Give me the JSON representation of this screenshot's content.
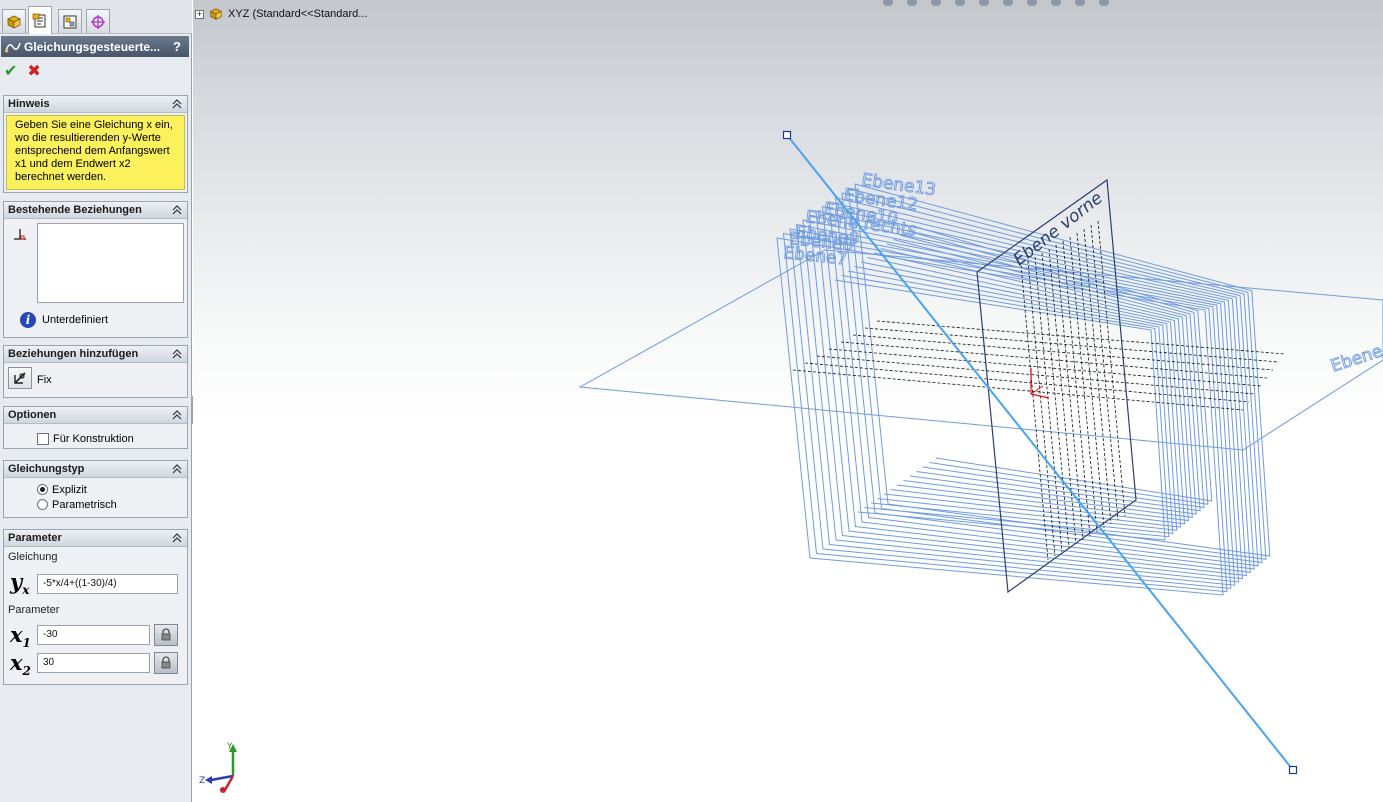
{
  "property_manager": {
    "header_title": "Gleichungsgesteuerte...",
    "help_label": "?",
    "ok_symbol": "✔",
    "cancel_symbol": "✖",
    "hint": {
      "title": "Hinweis",
      "text": "Geben Sie eine Gleichung x ein, wo die resultierenden y-Werte entsprechend dem Anfangswert x1 und dem Endwert x2 berechnet werden."
    },
    "existing_relations": {
      "title": "Bestehende Beziehungen",
      "status": "Unterdefiniert"
    },
    "add_relations": {
      "title": "Beziehungen hinzufügen",
      "fix_label": "Fix"
    },
    "options": {
      "title": "Optionen",
      "construction_label": "Für Konstruktion",
      "construction_checked": false
    },
    "equation_type": {
      "title": "Gleichungstyp",
      "options": [
        "Explizit",
        "Parametrisch"
      ],
      "selected": "Explizit"
    },
    "parameters": {
      "title": "Parameter",
      "equation_label": "Gleichung",
      "yx_symbol": "y",
      "yx_sub": "x",
      "equation_value": "-5*x/4+((1-30)/4)",
      "parameter_label": "Parameter",
      "x1_symbol": "x",
      "x1_sub": "1",
      "x1_value": "-30",
      "x2_symbol": "x",
      "x2_sub": "2",
      "x2_value": "30"
    }
  },
  "viewport": {
    "tree_item": "XYZ  (Standard<<Standard...",
    "plane_labels": [
      "Ebene13",
      "Ebene12",
      "Ebene10",
      "Ebene rechts",
      "Ebene9",
      "Ebene8",
      "Ebene7",
      "Ebene vorne",
      "Ebene"
    ],
    "triad": {
      "y": "Y",
      "z": "Z"
    },
    "colors": {
      "plane_blue": "#6f9be0",
      "sketch_line": "#4aa3ee",
      "front_plane": "#2b3f6e",
      "hint_yellow": "#fbf15c"
    }
  }
}
